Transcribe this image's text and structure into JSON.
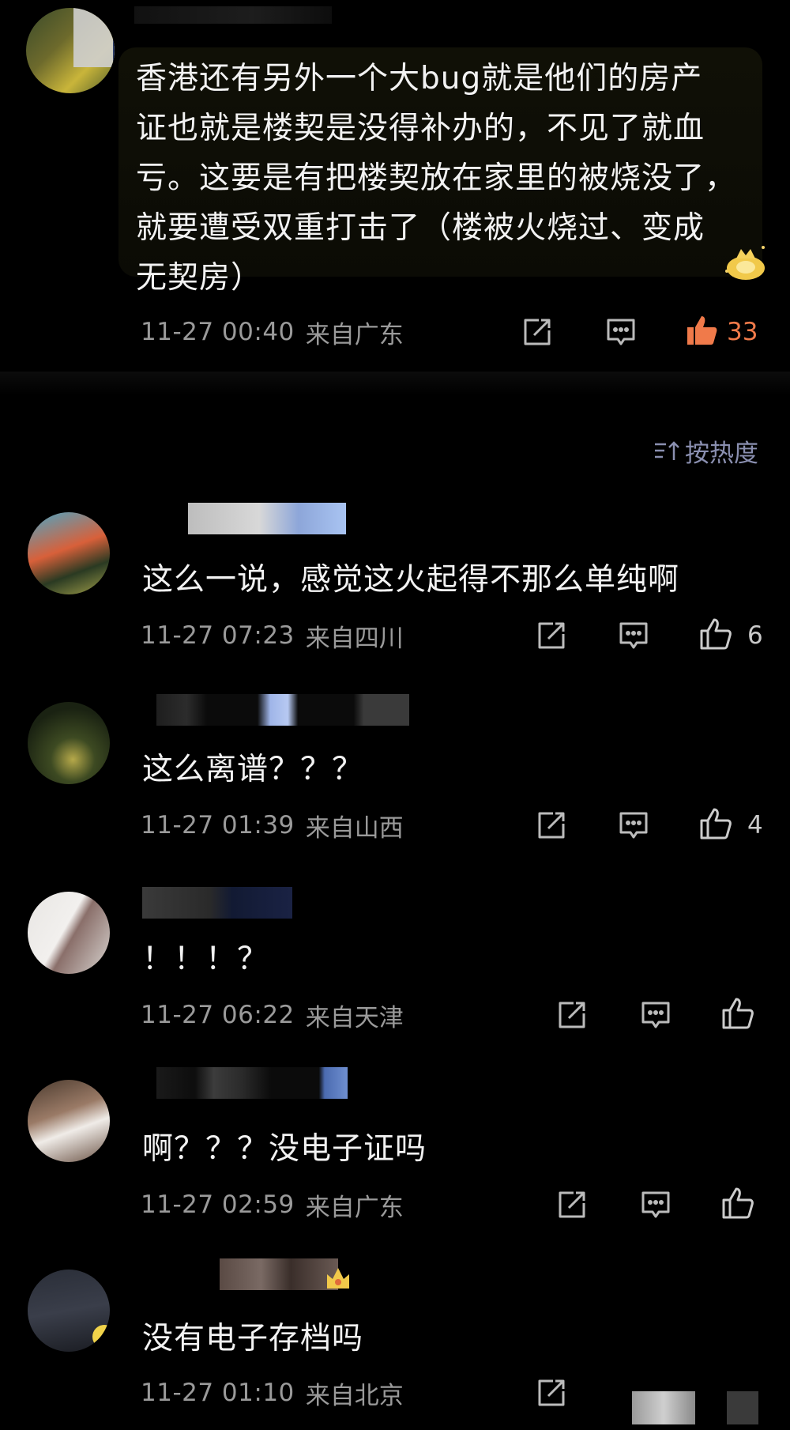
{
  "top_comment": {
    "text_lines": [
      "香港还有另外一个大bug就是他们的房产",
      "证也就是楼契是没得补办的，不见了就血",
      "亏。这要是有把楼契放在家里的被烧没了，",
      "就要遭受双重打击了（楼被火烧过、变成",
      "无契房）"
    ],
    "time": "11-27 00:40",
    "location": "来自广东",
    "likes": "33",
    "icons": [
      "share-icon",
      "comment-icon",
      "thumbs-up-icon",
      "crown-badge-icon"
    ]
  },
  "sort": {
    "label": "按热度",
    "icon": "sort-icon"
  },
  "replies": [
    {
      "text": "这么一说，感觉这火起得不那么单纯啊",
      "time": "11-27 07:23",
      "location": "来自四川",
      "likes": "6"
    },
    {
      "text": "这么离谱？？？",
      "time": "11-27 01:39",
      "location": "来自山西",
      "likes": "4"
    },
    {
      "text": "！！！？",
      "time": "11-27 06:22",
      "location": "来自天津",
      "likes": ""
    },
    {
      "text": "啊？？？没电子证吗",
      "time": "11-27 02:59",
      "location": "来自广东",
      "likes": ""
    },
    {
      "text": "没有电子存档吗",
      "time": "11-27 01:10",
      "location": "来自北京",
      "likes": ""
    }
  ],
  "colors": {
    "background": "#000000",
    "text": "#f2f2f2",
    "meta": "#9a9a9a",
    "hot_like": "#f07a4a",
    "sort": "#8a8fb0"
  }
}
